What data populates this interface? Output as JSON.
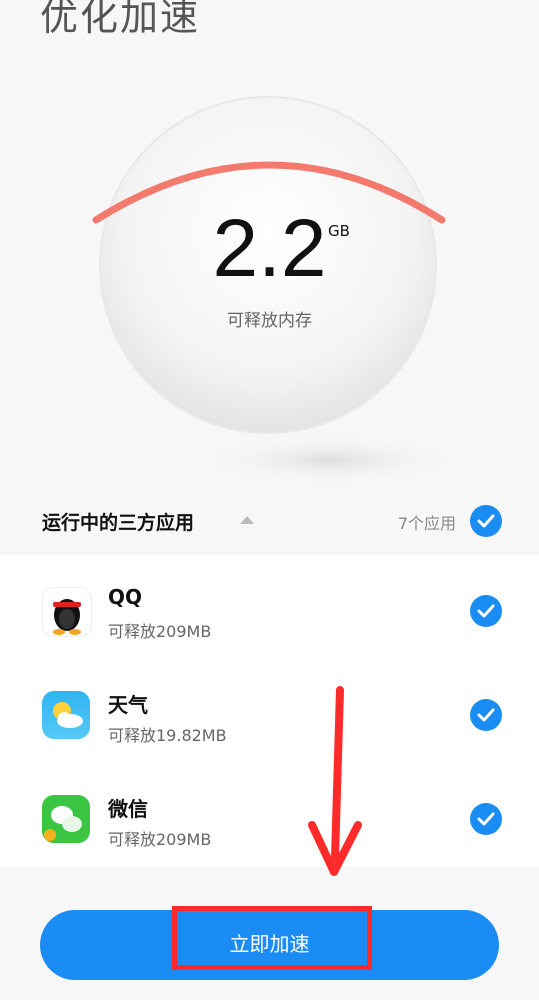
{
  "header": {
    "title": "优化加速"
  },
  "memory": {
    "value": "2.2",
    "unit": "GB",
    "label": "可释放内存"
  },
  "section": {
    "title": "运行中的三方应用",
    "count": "7个应用",
    "all_checked": true
  },
  "apps": [
    {
      "name": "QQ",
      "release": "可释放209MB",
      "icon": "qq-penguin-icon",
      "checked": true
    },
    {
      "name": "天气",
      "release": "可释放19.82MB",
      "icon": "weather-icon",
      "checked": true
    },
    {
      "name": "微信",
      "release": "可释放209MB",
      "icon": "wechat-icon",
      "checked": true
    }
  ],
  "action": {
    "label": "立即加速"
  },
  "colors": {
    "accent": "#1a8cf3",
    "annotation": "#ff2a2a",
    "arc": "#f26b5c"
  }
}
